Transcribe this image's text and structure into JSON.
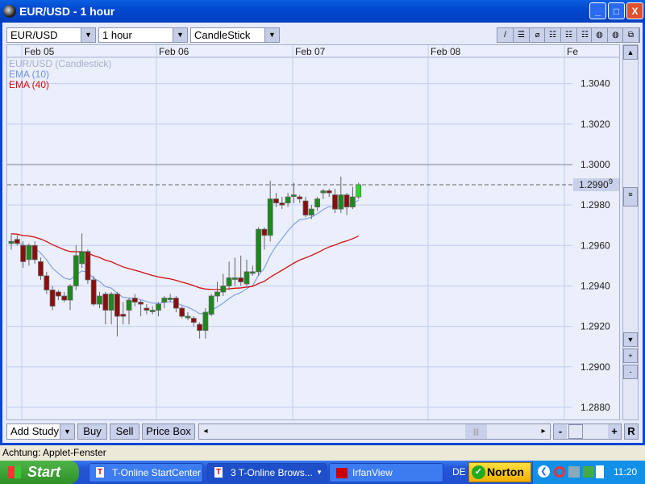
{
  "window": {
    "title": "EUR/USD - 1 hour",
    "min": "_",
    "max": "□",
    "close": "X"
  },
  "toolbar": {
    "symbol": "EUR/USD",
    "period": "1 hour",
    "chart_type": "CandleStick",
    "tools": [
      "/",
      "☰",
      "⌀",
      "☷",
      "☷",
      "☷",
      "◍",
      "◍",
      "⧉"
    ]
  },
  "legend": {
    "main": "EUR/USD (Candlestick)",
    "ema10": "EMA (10)",
    "ema40": "EMA (40)"
  },
  "colors": {
    "up": "#1a8a1a",
    "down": "#8b0d0d",
    "last_up": "#22dd22",
    "ema10": "#6f95e0",
    "ema40": "#d01010"
  },
  "chart_data": {
    "type": "candlestick",
    "x_labels": [
      "Feb 05",
      "Feb 06",
      "Feb 07",
      "Feb 08",
      "Fe"
    ],
    "y_ticks": [
      "1.3040",
      "1.3020",
      "1.3000",
      "1.2980",
      "1.2960",
      "1.2940",
      "1.2920",
      "1.2900",
      "1.2880"
    ],
    "ylim": [
      1.2874,
      1.3053
    ],
    "current_price": "1.2990",
    "current_price_sup": "9",
    "ema_periods": [
      10,
      40
    ],
    "ohlc": [
      [
        1.2961,
        1.2966,
        1.2958,
        1.2962
      ],
      [
        1.2963,
        1.2965,
        1.296,
        1.2961
      ],
      [
        1.296,
        1.2962,
        1.2949,
        1.2952
      ],
      [
        1.2953,
        1.2961,
        1.295,
        1.296
      ],
      [
        1.296,
        1.2962,
        1.2951,
        1.2953
      ],
      [
        1.2952,
        1.2954,
        1.2943,
        1.2945
      ],
      [
        1.2945,
        1.2947,
        1.2936,
        1.2938
      ],
      [
        1.2938,
        1.294,
        1.2928,
        1.293
      ],
      [
        1.2937,
        1.2938,
        1.2933,
        1.2935
      ],
      [
        1.2935,
        1.2937,
        1.2932,
        1.2933
      ],
      [
        1.2933,
        1.2941,
        1.2928,
        1.294
      ],
      [
        1.294,
        1.296,
        1.2938,
        1.2955
      ],
      [
        1.2951,
        1.2966,
        1.2949,
        1.2957
      ],
      [
        1.2957,
        1.2958,
        1.2941,
        1.2943
      ],
      [
        1.2943,
        1.2945,
        1.293,
        1.2931
      ],
      [
        1.2931,
        1.2937,
        1.2929,
        1.2935
      ],
      [
        1.2936,
        1.2937,
        1.2921,
        1.2928
      ],
      [
        1.2928,
        1.2937,
        1.2921,
        1.2936
      ],
      [
        1.2936,
        1.2937,
        1.2915,
        1.2925
      ],
      [
        1.2926,
        1.2932,
        1.2921,
        1.2925
      ],
      [
        1.2928,
        1.2934,
        1.2921,
        1.2933
      ],
      [
        1.2934,
        1.2936,
        1.293,
        1.2932
      ],
      [
        1.2932,
        1.2933,
        1.2925,
        1.2931
      ],
      [
        1.2929,
        1.2931,
        1.2926,
        1.2928
      ],
      [
        1.2928,
        1.293,
        1.2926,
        1.2928
      ],
      [
        1.2928,
        1.2932,
        1.2925,
        1.2931
      ],
      [
        1.2932,
        1.2935,
        1.2929,
        1.2934
      ],
      [
        1.2934,
        1.2936,
        1.2932,
        1.2934
      ],
      [
        1.2934,
        1.2935,
        1.2927,
        1.2929
      ],
      [
        1.2929,
        1.293,
        1.2924,
        1.2925
      ],
      [
        1.2925,
        1.2927,
        1.2923,
        1.2925
      ],
      [
        1.2924,
        1.2925,
        1.292,
        1.2922
      ],
      [
        1.2921,
        1.2922,
        1.2914,
        1.2918
      ],
      [
        1.2918,
        1.2929,
        1.2914,
        1.2927
      ],
      [
        1.2926,
        1.2936,
        1.2925,
        1.2935
      ],
      [
        1.2935,
        1.2942,
        1.2932,
        1.2937
      ],
      [
        1.2937,
        1.2946,
        1.2935,
        1.294
      ],
      [
        1.294,
        1.2952,
        1.2938,
        1.2944
      ],
      [
        1.2944,
        1.2954,
        1.294,
        1.2944
      ],
      [
        1.2944,
        1.2955,
        1.294,
        1.2942
      ],
      [
        1.2941,
        1.2953,
        1.294,
        1.2947
      ],
      [
        1.2947,
        1.295,
        1.2945,
        1.2947
      ],
      [
        1.2947,
        1.2969,
        1.2945,
        1.2968
      ],
      [
        1.2968,
        1.2969,
        1.2958,
        1.2965
      ],
      [
        1.2965,
        1.2992,
        1.2962,
        1.2983
      ],
      [
        1.2983,
        1.2986,
        1.2979,
        1.2981
      ],
      [
        1.2981,
        1.2984,
        1.2978,
        1.298
      ],
      [
        1.2981,
        1.2986,
        1.2979,
        1.2984
      ],
      [
        1.2985,
        1.2991,
        1.2981,
        1.2985
      ],
      [
        1.2984,
        1.2985,
        1.2981,
        1.2983
      ],
      [
        1.2982,
        1.2984,
        1.2974,
        1.2975
      ],
      [
        1.2975,
        1.298,
        1.2973,
        1.2978
      ],
      [
        1.2979,
        1.2984,
        1.2977,
        1.2983
      ],
      [
        1.2986,
        1.2988,
        1.2983,
        1.2987
      ],
      [
        1.2987,
        1.2988,
        1.2984,
        1.2986
      ],
      [
        1.2985,
        1.2988,
        1.2976,
        1.2978
      ],
      [
        1.2978,
        1.2994,
        1.2976,
        1.2985
      ],
      [
        1.2985,
        1.2986,
        1.2975,
        1.2979
      ],
      [
        1.2979,
        1.2989,
        1.2978,
        1.2984
      ],
      [
        1.2984,
        1.2991,
        1.2983,
        1.299
      ]
    ]
  },
  "bottom": {
    "add_study": "Add Study",
    "buy": "Buy",
    "sell": "Sell",
    "price_box": "Price Box",
    "minus": "-",
    "plus": "+",
    "reset": "R",
    "left": "◂",
    "right": "▸",
    "grip": "|||"
  },
  "status": "Achtung: Applet-Fenster",
  "taskbar": {
    "start": "Start",
    "tasks": [
      "T-Online StartCenter",
      "3  T-Online Brows...",
      "IrfanView"
    ],
    "lang": "DE",
    "norton": "Norton",
    "clock": "11:20"
  }
}
